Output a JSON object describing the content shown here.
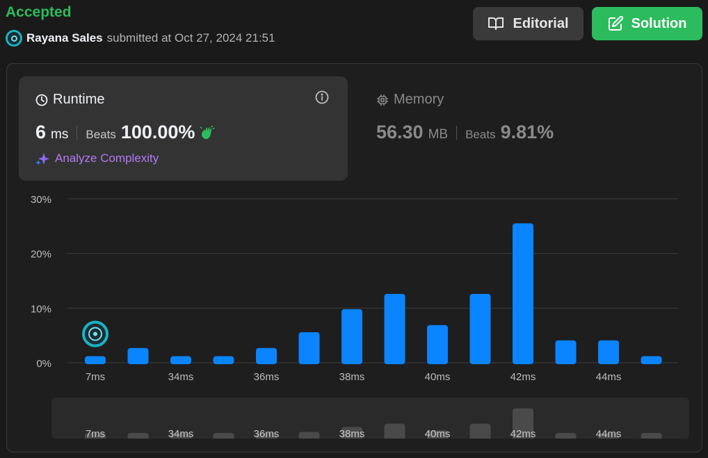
{
  "status": "Accepted",
  "submitter": {
    "name": "Rayana Sales",
    "submitted_text": "submitted at Oct 27, 2024 21:51"
  },
  "buttons": {
    "editorial": "Editorial",
    "solution": "Solution"
  },
  "runtime": {
    "label": "Runtime",
    "value": "6",
    "unit": "ms",
    "beats_label": "Beats",
    "beats_value": "100.00%",
    "analyze_label": "Analyze Complexity"
  },
  "memory": {
    "label": "Memory",
    "value": "56.30",
    "unit": "MB",
    "beats_label": "Beats",
    "beats_value": "9.81%"
  },
  "colors": {
    "accepted": "#2cbb5d",
    "bar": "#0a84ff",
    "analyze": "#b07bf2",
    "minimap_bar": "#4a4a4a"
  },
  "chart_data": {
    "type": "bar",
    "title": "",
    "xlabel": "",
    "ylabel": "",
    "ylim": [
      0,
      30
    ],
    "y_ticks": [
      "0%",
      "10%",
      "20%",
      "30%"
    ],
    "x_tick_labels": [
      "7ms",
      "34ms",
      "36ms",
      "38ms",
      "40ms",
      "42ms",
      "44ms"
    ],
    "labelled_bar_indices": [
      0,
      2,
      4,
      6,
      8,
      10,
      12
    ],
    "values": [
      1.2,
      2.7,
      1.2,
      1.2,
      2.7,
      5.6,
      9.8,
      12.6,
      6.9,
      12.6,
      25.5,
      4.1,
      4.1,
      1.2
    ],
    "user_bar_index": 0,
    "grid": true
  }
}
